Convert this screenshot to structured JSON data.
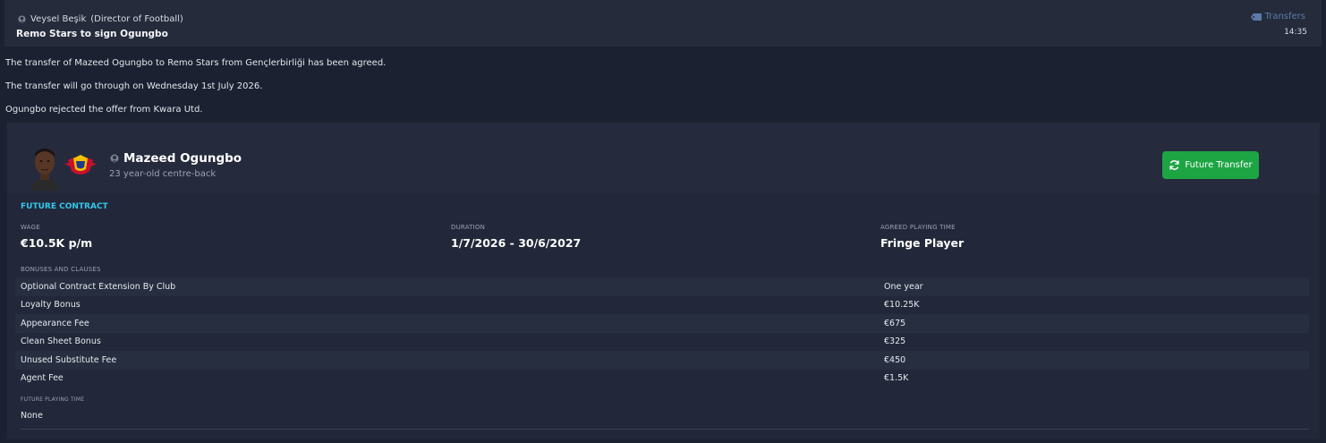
{
  "header": {
    "sender_name": "Veysel Beşik",
    "sender_role": "(Director of Football)",
    "title": "Remo Stars to sign Ogungbo",
    "category": "Transfers",
    "time": "14:35",
    "icons": {
      "sender": "person-icon",
      "category": "tag-icon"
    }
  },
  "messages": [
    "The transfer of Mazeed Ogungbo to Remo Stars from Gençlerbirliği has been agreed.",
    "The transfer will go through on Wednesday 1st July 2026.",
    "Ogungbo rejected the offer from Kwara Utd."
  ],
  "player": {
    "name": "Mazeed Ogungbo",
    "description": "23 year-old centre-back",
    "action_button": "Future Transfer",
    "icons": {
      "action": "refresh-icon",
      "name": "person-icon"
    }
  },
  "contract": {
    "section_title": "FUTURE CONTRACT",
    "wage_label": "WAGE",
    "wage_value": "€10.5K p/m",
    "duration_label": "DURATION",
    "duration_value": "1/7/2026 - 30/6/2027",
    "playing_time_label": "AGREED PLAYING TIME",
    "playing_time_value": "Fringe Player",
    "bonuses_label": "BONUSES AND CLAUSES",
    "bonuses": [
      {
        "name": "Optional Contract Extension By Club",
        "value": "One year"
      },
      {
        "name": "Loyalty Bonus",
        "value": "€10.25K"
      },
      {
        "name": "Appearance Fee",
        "value": "€675"
      },
      {
        "name": "Clean Sheet Bonus",
        "value": "€325"
      },
      {
        "name": "Unused Substitute Fee",
        "value": "€450"
      },
      {
        "name": "Agent Fee",
        "value": "€1.5K"
      }
    ],
    "future_playing_time_label": "FUTURE PLAYING TIME",
    "future_playing_time_value": "None"
  },
  "colors": {
    "accent_cyan": "#35c6ea",
    "button_green": "#1da544",
    "category_blue": "#5b7aa8"
  }
}
